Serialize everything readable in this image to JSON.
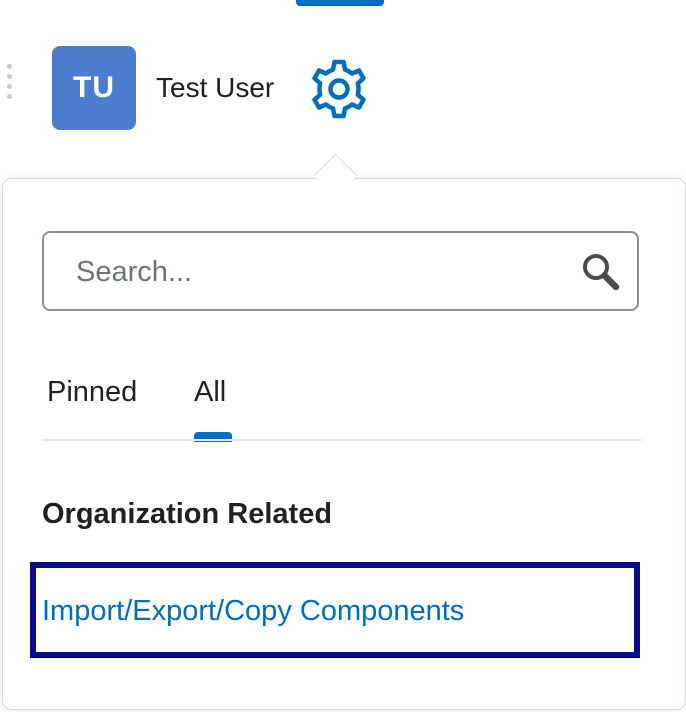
{
  "header": {
    "avatar_initials": "TU",
    "user_name": "Test User",
    "icons": {
      "settings": "gear-icon",
      "drag": "drag-handle-icon"
    },
    "accent_color": "#006fbf",
    "avatar_color": "#4d7ccf"
  },
  "dropdown": {
    "search": {
      "placeholder": "Search...",
      "value": "",
      "icon": "search-icon"
    },
    "tabs": [
      {
        "label": "Pinned",
        "selected": false
      },
      {
        "label": "All",
        "selected": true
      }
    ],
    "section": {
      "heading": "Organization Related",
      "items": [
        {
          "label": "Import/Export/Copy Components",
          "highlighted": true
        }
      ]
    },
    "highlight_color": "#0c0a8f"
  }
}
